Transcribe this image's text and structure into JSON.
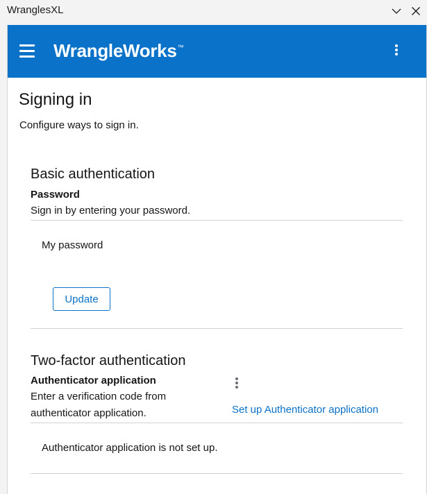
{
  "window": {
    "title": "WranglesXL"
  },
  "header": {
    "brand": "WrangleWorks",
    "brand_mark": "™"
  },
  "page": {
    "title": "Signing in",
    "description": "Configure ways to sign in."
  },
  "basic_auth": {
    "title": "Basic authentication",
    "subtitle": "Password",
    "description": "Sign in by entering your password.",
    "item_label": "My password",
    "update_label": "Update"
  },
  "two_factor": {
    "title": "Two-factor authentication",
    "subtitle": "Authenticator application",
    "description": "Enter a verification code from authenticator application.",
    "setup_link": "Set up Authenticator application",
    "status": "Authenticator application is not set up."
  },
  "colors": {
    "accent": "#0b72c9",
    "divider": "#d2d2d2"
  },
  "icons": {
    "menu": "hamburger-menu-icon",
    "header_options": "kebab-menu-icon",
    "card_options": "kebab-menu-icon",
    "window_collapse": "chevron-down-icon",
    "window_close": "close-icon"
  }
}
